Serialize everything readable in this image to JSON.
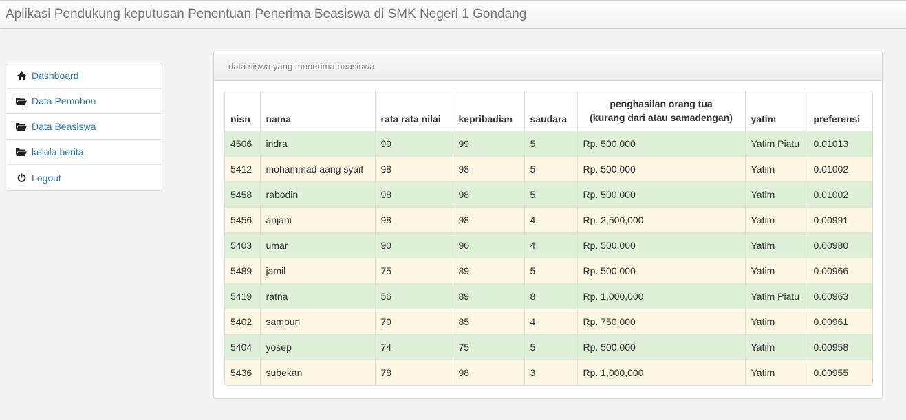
{
  "app": {
    "title": "Aplikasi Pendukung keputusan Penentuan Penerima Beasiswa di SMK Negeri 1 Gondang"
  },
  "sidebar": {
    "items": [
      {
        "label": "Dashboard",
        "icon": "home-icon"
      },
      {
        "label": "Data Pemohon",
        "icon": "folder-open-icon"
      },
      {
        "label": "Data Beasiswa",
        "icon": "folder-open-icon"
      },
      {
        "label": "kelola berita",
        "icon": "folder-open-icon"
      },
      {
        "label": "Logout",
        "icon": "power-icon"
      }
    ]
  },
  "panel": {
    "title": "data siswa yang menerima beasiswa"
  },
  "table": {
    "headers": {
      "nisn": "nisn",
      "nama": "nama",
      "nilai": "rata rata nilai",
      "kepribadian": "kepribadian",
      "saudara": "saudara",
      "penghasilan_1": "penghasilan orang tua",
      "penghasilan_2": "(kurang dari atau samadengan)",
      "yatim": "yatim",
      "preferensi": "preferensi"
    },
    "rows": [
      {
        "nisn": "4506",
        "nama": "indra",
        "nilai": "99",
        "kepribadian": "99",
        "saudara": "5",
        "penghasilan": "Rp. 500,000",
        "yatim": "Yatim Piatu",
        "preferensi": "0.01013"
      },
      {
        "nisn": "5412",
        "nama": "mohammad aang syaif",
        "nilai": "98",
        "kepribadian": "98",
        "saudara": "5",
        "penghasilan": "Rp. 500,000",
        "yatim": "Yatim",
        "preferensi": "0.01002"
      },
      {
        "nisn": "5458",
        "nama": "rabodin",
        "nilai": "98",
        "kepribadian": "98",
        "saudara": "5",
        "penghasilan": "Rp. 500,000",
        "yatim": "Yatim",
        "preferensi": "0.01002"
      },
      {
        "nisn": "5456",
        "nama": "anjani",
        "nilai": "98",
        "kepribadian": "98",
        "saudara": "4",
        "penghasilan": "Rp. 2,500,000",
        "yatim": "Yatim",
        "preferensi": "0.00991"
      },
      {
        "nisn": "5403",
        "nama": "umar",
        "nilai": "90",
        "kepribadian": "90",
        "saudara": "4",
        "penghasilan": "Rp. 500,000",
        "yatim": "Yatim",
        "preferensi": "0.00980"
      },
      {
        "nisn": "5489",
        "nama": "jamil",
        "nilai": "75",
        "kepribadian": "89",
        "saudara": "5",
        "penghasilan": "Rp. 500,000",
        "yatim": "Yatim",
        "preferensi": "0.00966"
      },
      {
        "nisn": "5419",
        "nama": "ratna",
        "nilai": "56",
        "kepribadian": "89",
        "saudara": "8",
        "penghasilan": "Rp. 1,000,000",
        "yatim": "Yatim Piatu",
        "preferensi": "0.00963"
      },
      {
        "nisn": "5402",
        "nama": "sampun",
        "nilai": "79",
        "kepribadian": "85",
        "saudara": "4",
        "penghasilan": "Rp. 750,000",
        "yatim": "Yatim",
        "preferensi": "0.00961"
      },
      {
        "nisn": "5404",
        "nama": "yosep",
        "nilai": "74",
        "kepribadian": "75",
        "saudara": "5",
        "penghasilan": "Rp. 500,000",
        "yatim": "Yatim",
        "preferensi": "0.00958"
      },
      {
        "nisn": "5436",
        "nama": "subekan",
        "nilai": "78",
        "kepribadian": "98",
        "saudara": "3",
        "penghasilan": "Rp. 1,000,000",
        "yatim": "Yatim",
        "preferensi": "0.00955"
      }
    ]
  },
  "colors": {
    "row_green": "#dff0d8",
    "row_yellow": "#fcf8e3",
    "link": "#2a7ab8"
  }
}
